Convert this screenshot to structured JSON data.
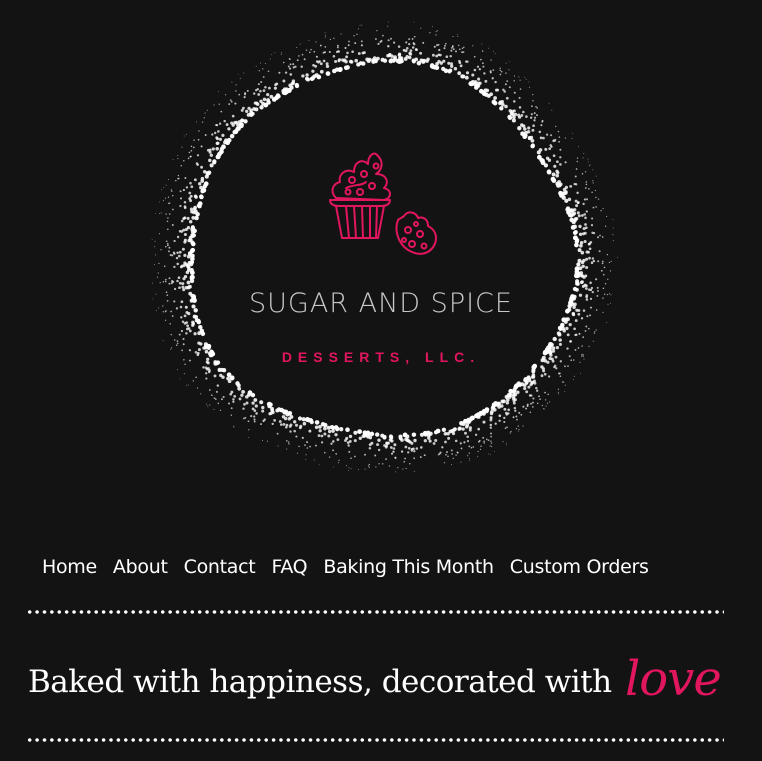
{
  "logo": {
    "brand_name": "SUGAR AND SPICE",
    "brand_sub": "DESSERTS, LLC.",
    "icon": "cupcake-and-cookie-icon",
    "accent_color": "#e2155f",
    "ring_color": "#ffffff"
  },
  "nav": {
    "items": [
      {
        "label": "Home"
      },
      {
        "label": "About"
      },
      {
        "label": "Contact"
      },
      {
        "label": "FAQ"
      },
      {
        "label": "Baking This Month"
      },
      {
        "label": "Custom Orders"
      }
    ]
  },
  "tagline": {
    "text": "Baked with happiness, decorated with",
    "highlight": "love"
  },
  "colors": {
    "background": "#141314",
    "text": "#ffffff",
    "accent": "#e2155f"
  }
}
